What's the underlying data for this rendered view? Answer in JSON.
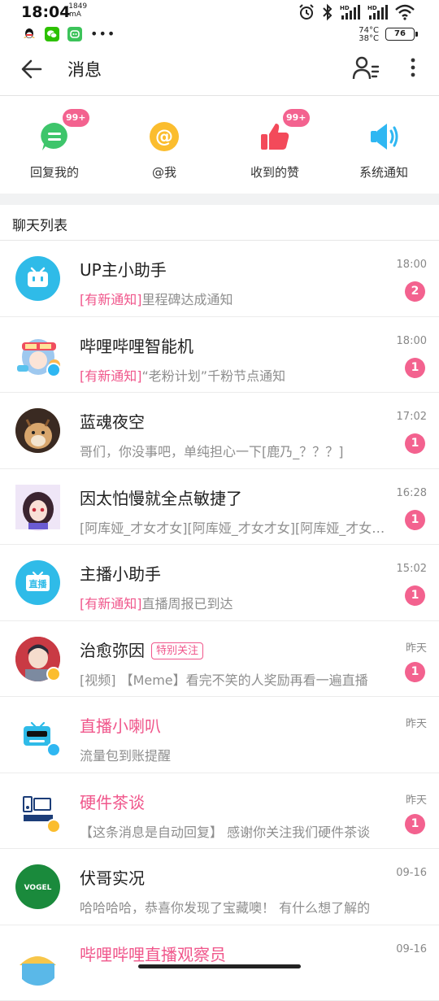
{
  "status_bar": {
    "time": "18:04",
    "speed_top": "-1849",
    "speed_bottom": "mA",
    "temp_top": "74°C",
    "temp_bottom": "38°C",
    "battery": "76"
  },
  "header": {
    "title": "消息"
  },
  "quick": [
    {
      "label": "回复我的",
      "badge": "99+",
      "icon": "reply-icon"
    },
    {
      "label": "@我",
      "badge": "",
      "icon": "at-icon"
    },
    {
      "label": "收到的赞",
      "badge": "99+",
      "icon": "thumb-up-icon"
    },
    {
      "label": "系统通知",
      "badge": "",
      "icon": "speaker-icon"
    }
  ],
  "section_title": "聊天列表",
  "chats": [
    {
      "name": "UP主小助手",
      "tag": "",
      "pink_name": false,
      "prefix": "[有新通知]",
      "text": "里程碑达成通知",
      "time": "18:00",
      "count": "2"
    },
    {
      "name": "哔哩哔哩智能机",
      "tag": "",
      "pink_name": false,
      "prefix": "[有新通知]",
      "text": "“老粉计划”千粉节点通知",
      "time": "18:00",
      "count": "1"
    },
    {
      "name": "蓝魂夜空",
      "tag": "",
      "pink_name": false,
      "prefix": "",
      "text": "哥们，你没事吧，单纯担心一下[鹿乃_？？？]",
      "time": "17:02",
      "count": "1"
    },
    {
      "name": "因太怕慢就全点敏捷了",
      "tag": "",
      "pink_name": false,
      "prefix": "",
      "text": "[阿库娅_才女才女][阿库娅_才女才女][阿库娅_才女才女]",
      "time": "16:28",
      "count": "1"
    },
    {
      "name": "主播小助手",
      "tag": "",
      "pink_name": false,
      "prefix": "[有新通知]",
      "text": "直播周报已到达",
      "time": "15:02",
      "count": "1"
    },
    {
      "name": "治愈弥因",
      "tag": "特别关注",
      "pink_name": false,
      "prefix": "",
      "text": "[视频] 【Meme】看完不笑的人奖励再看一遍直播",
      "time": "昨天",
      "count": "1"
    },
    {
      "name": "直播小喇叭",
      "tag": "",
      "pink_name": true,
      "prefix": "",
      "text": "流量包到账提醒",
      "time": "昨天",
      "count": ""
    },
    {
      "name": "硬件茶谈",
      "tag": "",
      "pink_name": true,
      "prefix": "",
      "text": "【这条消息是自动回复】 感谢你关注我们硬件茶谈",
      "time": "昨天",
      "count": "1"
    },
    {
      "name": "伏哥实况",
      "tag": "",
      "pink_name": false,
      "prefix": "",
      "text": "哈哈哈哈，恭喜你发现了宝藏噢！ 有什么想了解的",
      "time": "09-16",
      "count": ""
    },
    {
      "name": "哔哩哔哩直播观察员",
      "tag": "",
      "pink_name": true,
      "prefix": "",
      "text": "",
      "time": "09-16",
      "count": ""
    }
  ],
  "avatar_text": {
    "live": "直播",
    "vogel": "VOGEL"
  },
  "colors": {
    "accent": "#f0568b",
    "badge": "#f3628f",
    "blue": "#2fbbe8"
  }
}
